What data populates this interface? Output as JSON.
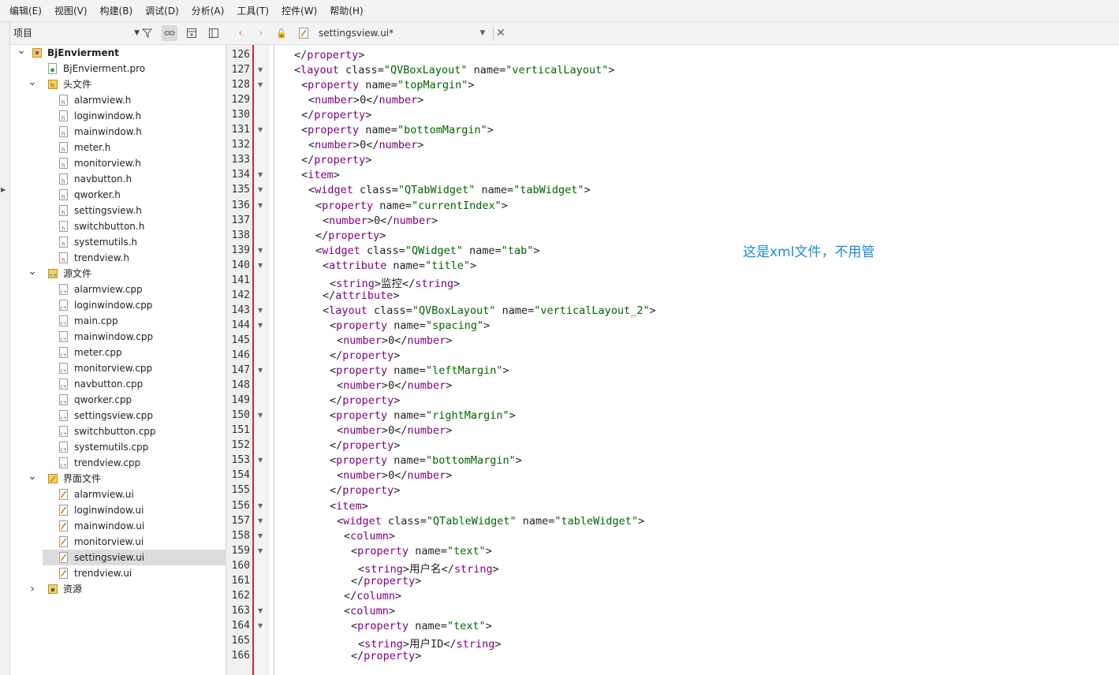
{
  "menu": [
    "编辑(E)",
    "视图(V)",
    "构建(B)",
    "调试(D)",
    "分析(A)",
    "工具(T)",
    "控件(W)",
    "帮助(H)"
  ],
  "project_panel": {
    "combo_label": "项目",
    "tools": [
      "filter-icon",
      "link-icon",
      "add-split-icon",
      "split-icon"
    ]
  },
  "tree": [
    {
      "level": 0,
      "expanded": true,
      "type": "project",
      "label": "BjEnvierment",
      "bold": true
    },
    {
      "level": 1,
      "type": "pro",
      "label": "BjEnvierment.pro"
    },
    {
      "level": 1,
      "expanded": true,
      "type": "folder-h",
      "label": "头文件"
    },
    {
      "level": 2,
      "type": "h",
      "label": "alarmview.h"
    },
    {
      "level": 2,
      "type": "h",
      "label": "loginwindow.h"
    },
    {
      "level": 2,
      "type": "h",
      "label": "mainwindow.h"
    },
    {
      "level": 2,
      "type": "h",
      "label": "meter.h"
    },
    {
      "level": 2,
      "type": "h",
      "label": "monitorview.h"
    },
    {
      "level": 2,
      "type": "h",
      "label": "navbutton.h"
    },
    {
      "level": 2,
      "type": "h",
      "label": "qworker.h"
    },
    {
      "level": 2,
      "type": "h",
      "label": "settingsview.h"
    },
    {
      "level": 2,
      "type": "h",
      "label": "switchbutton.h"
    },
    {
      "level": 2,
      "type": "h",
      "label": "systemutils.h"
    },
    {
      "level": 2,
      "type": "h",
      "label": "trendview.h"
    },
    {
      "level": 1,
      "expanded": true,
      "type": "folder-cpp",
      "label": "源文件"
    },
    {
      "level": 2,
      "type": "cpp",
      "label": "alarmview.cpp"
    },
    {
      "level": 2,
      "type": "cpp",
      "label": "loginwindow.cpp"
    },
    {
      "level": 2,
      "type": "cpp",
      "label": "main.cpp"
    },
    {
      "level": 2,
      "type": "cpp",
      "label": "mainwindow.cpp"
    },
    {
      "level": 2,
      "type": "cpp",
      "label": "meter.cpp"
    },
    {
      "level": 2,
      "type": "cpp",
      "label": "monitorview.cpp"
    },
    {
      "level": 2,
      "type": "cpp",
      "label": "navbutton.cpp"
    },
    {
      "level": 2,
      "type": "cpp",
      "label": "qworker.cpp"
    },
    {
      "level": 2,
      "type": "cpp",
      "label": "settingsview.cpp"
    },
    {
      "level": 2,
      "type": "cpp",
      "label": "switchbutton.cpp"
    },
    {
      "level": 2,
      "type": "cpp",
      "label": "systemutils.cpp"
    },
    {
      "level": 2,
      "type": "cpp",
      "label": "trendview.cpp"
    },
    {
      "level": 1,
      "expanded": true,
      "type": "folder-ui",
      "label": "界面文件"
    },
    {
      "level": 2,
      "type": "ui",
      "label": "alarmview.ui"
    },
    {
      "level": 2,
      "type": "ui",
      "label": "loginwindow.ui"
    },
    {
      "level": 2,
      "type": "ui",
      "label": "mainwindow.ui"
    },
    {
      "level": 2,
      "type": "ui",
      "label": "monitorview.ui"
    },
    {
      "level": 2,
      "type": "ui",
      "label": "settingsview.ui",
      "selected": true
    },
    {
      "level": 2,
      "type": "ui",
      "label": "trendview.ui"
    },
    {
      "level": 1,
      "expanded": false,
      "type": "folder-res",
      "label": "资源"
    }
  ],
  "editor_tab": {
    "title": "settingsview.ui*"
  },
  "code_lines": [
    {
      "n": 126,
      "fold": false,
      "indent": 2,
      "parts": [
        [
          "p",
          "</"
        ],
        [
          "tag",
          "property"
        ],
        [
          "p",
          ">"
        ]
      ]
    },
    {
      "n": 127,
      "fold": true,
      "indent": 2,
      "parts": [
        [
          "p",
          "<"
        ],
        [
          "tag",
          "layout"
        ],
        [
          "attr",
          " class="
        ],
        [
          "str",
          "\"QVBoxLayout\""
        ],
        [
          "attr",
          " name="
        ],
        [
          "str",
          "\"verticalLayout\""
        ],
        [
          "p",
          ">"
        ]
      ]
    },
    {
      "n": 128,
      "fold": true,
      "indent": 3,
      "parts": [
        [
          "p",
          "<"
        ],
        [
          "tag",
          "property"
        ],
        [
          "attr",
          " name="
        ],
        [
          "str",
          "\"topMargin\""
        ],
        [
          "p",
          ">"
        ]
      ]
    },
    {
      "n": 129,
      "fold": false,
      "indent": 4,
      "parts": [
        [
          "p",
          "<"
        ],
        [
          "tag",
          "number"
        ],
        [
          "p",
          ">"
        ],
        [
          "txt",
          "0"
        ],
        [
          "p",
          "</"
        ],
        [
          "tag",
          "number"
        ],
        [
          "p",
          ">"
        ]
      ]
    },
    {
      "n": 130,
      "fold": false,
      "indent": 3,
      "parts": [
        [
          "p",
          "</"
        ],
        [
          "tag",
          "property"
        ],
        [
          "p",
          ">"
        ]
      ]
    },
    {
      "n": 131,
      "fold": true,
      "indent": 3,
      "parts": [
        [
          "p",
          "<"
        ],
        [
          "tag",
          "property"
        ],
        [
          "attr",
          " name="
        ],
        [
          "str",
          "\"bottomMargin\""
        ],
        [
          "p",
          ">"
        ]
      ]
    },
    {
      "n": 132,
      "fold": false,
      "indent": 4,
      "parts": [
        [
          "p",
          "<"
        ],
        [
          "tag",
          "number"
        ],
        [
          "p",
          ">"
        ],
        [
          "txt",
          "0"
        ],
        [
          "p",
          "</"
        ],
        [
          "tag",
          "number"
        ],
        [
          "p",
          ">"
        ]
      ]
    },
    {
      "n": 133,
      "fold": false,
      "indent": 3,
      "parts": [
        [
          "p",
          "</"
        ],
        [
          "tag",
          "property"
        ],
        [
          "p",
          ">"
        ]
      ]
    },
    {
      "n": 134,
      "fold": true,
      "indent": 3,
      "parts": [
        [
          "p",
          "<"
        ],
        [
          "tag",
          "item"
        ],
        [
          "p",
          ">"
        ]
      ]
    },
    {
      "n": 135,
      "fold": true,
      "indent": 4,
      "parts": [
        [
          "p",
          "<"
        ],
        [
          "tag",
          "widget"
        ],
        [
          "attr",
          " class="
        ],
        [
          "str",
          "\"QTabWidget\""
        ],
        [
          "attr",
          " name="
        ],
        [
          "str",
          "\"tabWidget\""
        ],
        [
          "p",
          ">"
        ]
      ]
    },
    {
      "n": 136,
      "fold": true,
      "indent": 5,
      "parts": [
        [
          "p",
          "<"
        ],
        [
          "tag",
          "property"
        ],
        [
          "attr",
          " name="
        ],
        [
          "str",
          "\"currentIndex\""
        ],
        [
          "p",
          ">"
        ]
      ]
    },
    {
      "n": 137,
      "fold": false,
      "indent": 6,
      "parts": [
        [
          "p",
          "<"
        ],
        [
          "tag",
          "number"
        ],
        [
          "p",
          ">"
        ],
        [
          "txt",
          "0"
        ],
        [
          "p",
          "</"
        ],
        [
          "tag",
          "number"
        ],
        [
          "p",
          ">"
        ]
      ]
    },
    {
      "n": 138,
      "fold": false,
      "indent": 5,
      "parts": [
        [
          "p",
          "</"
        ],
        [
          "tag",
          "property"
        ],
        [
          "p",
          ">"
        ]
      ]
    },
    {
      "n": 139,
      "fold": true,
      "indent": 5,
      "parts": [
        [
          "p",
          "<"
        ],
        [
          "tag",
          "widget"
        ],
        [
          "attr",
          " class="
        ],
        [
          "str",
          "\"QWidget\""
        ],
        [
          "attr",
          " name="
        ],
        [
          "str",
          "\"tab\""
        ],
        [
          "p",
          ">"
        ]
      ]
    },
    {
      "n": 140,
      "fold": true,
      "indent": 6,
      "parts": [
        [
          "p",
          "<"
        ],
        [
          "tag",
          "attribute"
        ],
        [
          "attr",
          " name="
        ],
        [
          "str",
          "\"title\""
        ],
        [
          "p",
          ">"
        ]
      ]
    },
    {
      "n": 141,
      "fold": false,
      "indent": 7,
      "parts": [
        [
          "p",
          "<"
        ],
        [
          "tag",
          "string"
        ],
        [
          "p",
          ">"
        ],
        [
          "txt",
          "监控"
        ],
        [
          "p",
          "</"
        ],
        [
          "tag",
          "string"
        ],
        [
          "p",
          ">"
        ]
      ]
    },
    {
      "n": 142,
      "fold": false,
      "indent": 6,
      "parts": [
        [
          "p",
          "</"
        ],
        [
          "tag",
          "attribute"
        ],
        [
          "p",
          ">"
        ]
      ]
    },
    {
      "n": 143,
      "fold": true,
      "indent": 6,
      "parts": [
        [
          "p",
          "<"
        ],
        [
          "tag",
          "layout"
        ],
        [
          "attr",
          " class="
        ],
        [
          "str",
          "\"QVBoxLayout\""
        ],
        [
          "attr",
          " name="
        ],
        [
          "str",
          "\"verticalLayout_2\""
        ],
        [
          "p",
          ">"
        ]
      ]
    },
    {
      "n": 144,
      "fold": true,
      "indent": 7,
      "parts": [
        [
          "p",
          "<"
        ],
        [
          "tag",
          "property"
        ],
        [
          "attr",
          " name="
        ],
        [
          "str",
          "\"spacing\""
        ],
        [
          "p",
          ">"
        ]
      ]
    },
    {
      "n": 145,
      "fold": false,
      "indent": 8,
      "parts": [
        [
          "p",
          "<"
        ],
        [
          "tag",
          "number"
        ],
        [
          "p",
          ">"
        ],
        [
          "txt",
          "0"
        ],
        [
          "p",
          "</"
        ],
        [
          "tag",
          "number"
        ],
        [
          "p",
          ">"
        ]
      ]
    },
    {
      "n": 146,
      "fold": false,
      "indent": 7,
      "parts": [
        [
          "p",
          "</"
        ],
        [
          "tag",
          "property"
        ],
        [
          "p",
          ">"
        ]
      ]
    },
    {
      "n": 147,
      "fold": true,
      "indent": 7,
      "parts": [
        [
          "p",
          "<"
        ],
        [
          "tag",
          "property"
        ],
        [
          "attr",
          " name="
        ],
        [
          "str",
          "\"leftMargin\""
        ],
        [
          "p",
          ">"
        ]
      ]
    },
    {
      "n": 148,
      "fold": false,
      "indent": 8,
      "parts": [
        [
          "p",
          "<"
        ],
        [
          "tag",
          "number"
        ],
        [
          "p",
          ">"
        ],
        [
          "txt",
          "0"
        ],
        [
          "p",
          "</"
        ],
        [
          "tag",
          "number"
        ],
        [
          "p",
          ">"
        ]
      ]
    },
    {
      "n": 149,
      "fold": false,
      "indent": 7,
      "parts": [
        [
          "p",
          "</"
        ],
        [
          "tag",
          "property"
        ],
        [
          "p",
          ">"
        ]
      ]
    },
    {
      "n": 150,
      "fold": true,
      "indent": 7,
      "parts": [
        [
          "p",
          "<"
        ],
        [
          "tag",
          "property"
        ],
        [
          "attr",
          " name="
        ],
        [
          "str",
          "\"rightMargin\""
        ],
        [
          "p",
          ">"
        ]
      ]
    },
    {
      "n": 151,
      "fold": false,
      "indent": 8,
      "parts": [
        [
          "p",
          "<"
        ],
        [
          "tag",
          "number"
        ],
        [
          "p",
          ">"
        ],
        [
          "txt",
          "0"
        ],
        [
          "p",
          "</"
        ],
        [
          "tag",
          "number"
        ],
        [
          "p",
          ">"
        ]
      ]
    },
    {
      "n": 152,
      "fold": false,
      "indent": 7,
      "parts": [
        [
          "p",
          "</"
        ],
        [
          "tag",
          "property"
        ],
        [
          "p",
          ">"
        ]
      ]
    },
    {
      "n": 153,
      "fold": true,
      "indent": 7,
      "parts": [
        [
          "p",
          "<"
        ],
        [
          "tag",
          "property"
        ],
        [
          "attr",
          " name="
        ],
        [
          "str",
          "\"bottomMargin\""
        ],
        [
          "p",
          ">"
        ]
      ]
    },
    {
      "n": 154,
      "fold": false,
      "indent": 8,
      "parts": [
        [
          "p",
          "<"
        ],
        [
          "tag",
          "number"
        ],
        [
          "p",
          ">"
        ],
        [
          "txt",
          "0"
        ],
        [
          "p",
          "</"
        ],
        [
          "tag",
          "number"
        ],
        [
          "p",
          ">"
        ]
      ]
    },
    {
      "n": 155,
      "fold": false,
      "indent": 7,
      "parts": [
        [
          "p",
          "</"
        ],
        [
          "tag",
          "property"
        ],
        [
          "p",
          ">"
        ]
      ]
    },
    {
      "n": 156,
      "fold": true,
      "indent": 7,
      "parts": [
        [
          "p",
          "<"
        ],
        [
          "tag",
          "item"
        ],
        [
          "p",
          ">"
        ]
      ]
    },
    {
      "n": 157,
      "fold": true,
      "indent": 8,
      "parts": [
        [
          "p",
          "<"
        ],
        [
          "tag",
          "widget"
        ],
        [
          "attr",
          " class="
        ],
        [
          "str",
          "\"QTableWidget\""
        ],
        [
          "attr",
          " name="
        ],
        [
          "str",
          "\"tableWidget\""
        ],
        [
          "p",
          ">"
        ]
      ]
    },
    {
      "n": 158,
      "fold": true,
      "indent": 9,
      "parts": [
        [
          "p",
          "<"
        ],
        [
          "tag",
          "column"
        ],
        [
          "p",
          ">"
        ]
      ]
    },
    {
      "n": 159,
      "fold": true,
      "indent": 10,
      "parts": [
        [
          "p",
          "<"
        ],
        [
          "tag",
          "property"
        ],
        [
          "attr",
          " name="
        ],
        [
          "str",
          "\"text\""
        ],
        [
          "p",
          ">"
        ]
      ]
    },
    {
      "n": 160,
      "fold": false,
      "indent": 11,
      "parts": [
        [
          "p",
          "<"
        ],
        [
          "tag",
          "string"
        ],
        [
          "p",
          ">"
        ],
        [
          "txt",
          "用户名"
        ],
        [
          "p",
          "</"
        ],
        [
          "tag",
          "string"
        ],
        [
          "p",
          ">"
        ]
      ]
    },
    {
      "n": 161,
      "fold": false,
      "indent": 10,
      "parts": [
        [
          "p",
          "</"
        ],
        [
          "tag",
          "property"
        ],
        [
          "p",
          ">"
        ]
      ]
    },
    {
      "n": 162,
      "fold": false,
      "indent": 9,
      "parts": [
        [
          "p",
          "</"
        ],
        [
          "tag",
          "column"
        ],
        [
          "p",
          ">"
        ]
      ]
    },
    {
      "n": 163,
      "fold": true,
      "indent": 9,
      "parts": [
        [
          "p",
          "<"
        ],
        [
          "tag",
          "column"
        ],
        [
          "p",
          ">"
        ]
      ]
    },
    {
      "n": 164,
      "fold": true,
      "indent": 10,
      "parts": [
        [
          "p",
          "<"
        ],
        [
          "tag",
          "property"
        ],
        [
          "attr",
          " name="
        ],
        [
          "str",
          "\"text\""
        ],
        [
          "p",
          ">"
        ]
      ]
    },
    {
      "n": 165,
      "fold": false,
      "indent": 11,
      "parts": [
        [
          "p",
          "<"
        ],
        [
          "tag",
          "string"
        ],
        [
          "p",
          ">"
        ],
        [
          "txt",
          "用户ID"
        ],
        [
          "p",
          "</"
        ],
        [
          "tag",
          "string"
        ],
        [
          "p",
          ">"
        ]
      ]
    },
    {
      "n": 166,
      "fold": false,
      "indent": 10,
      "parts": [
        [
          "p",
          "</"
        ],
        [
          "tag",
          "property"
        ],
        [
          "p",
          ">"
        ]
      ]
    }
  ],
  "note": "这是xml文件，不用管",
  "colors": {
    "tag": "#800080",
    "string": "#006400",
    "note": "#1a8cd8",
    "gutter_marker": "#d22b2b"
  }
}
